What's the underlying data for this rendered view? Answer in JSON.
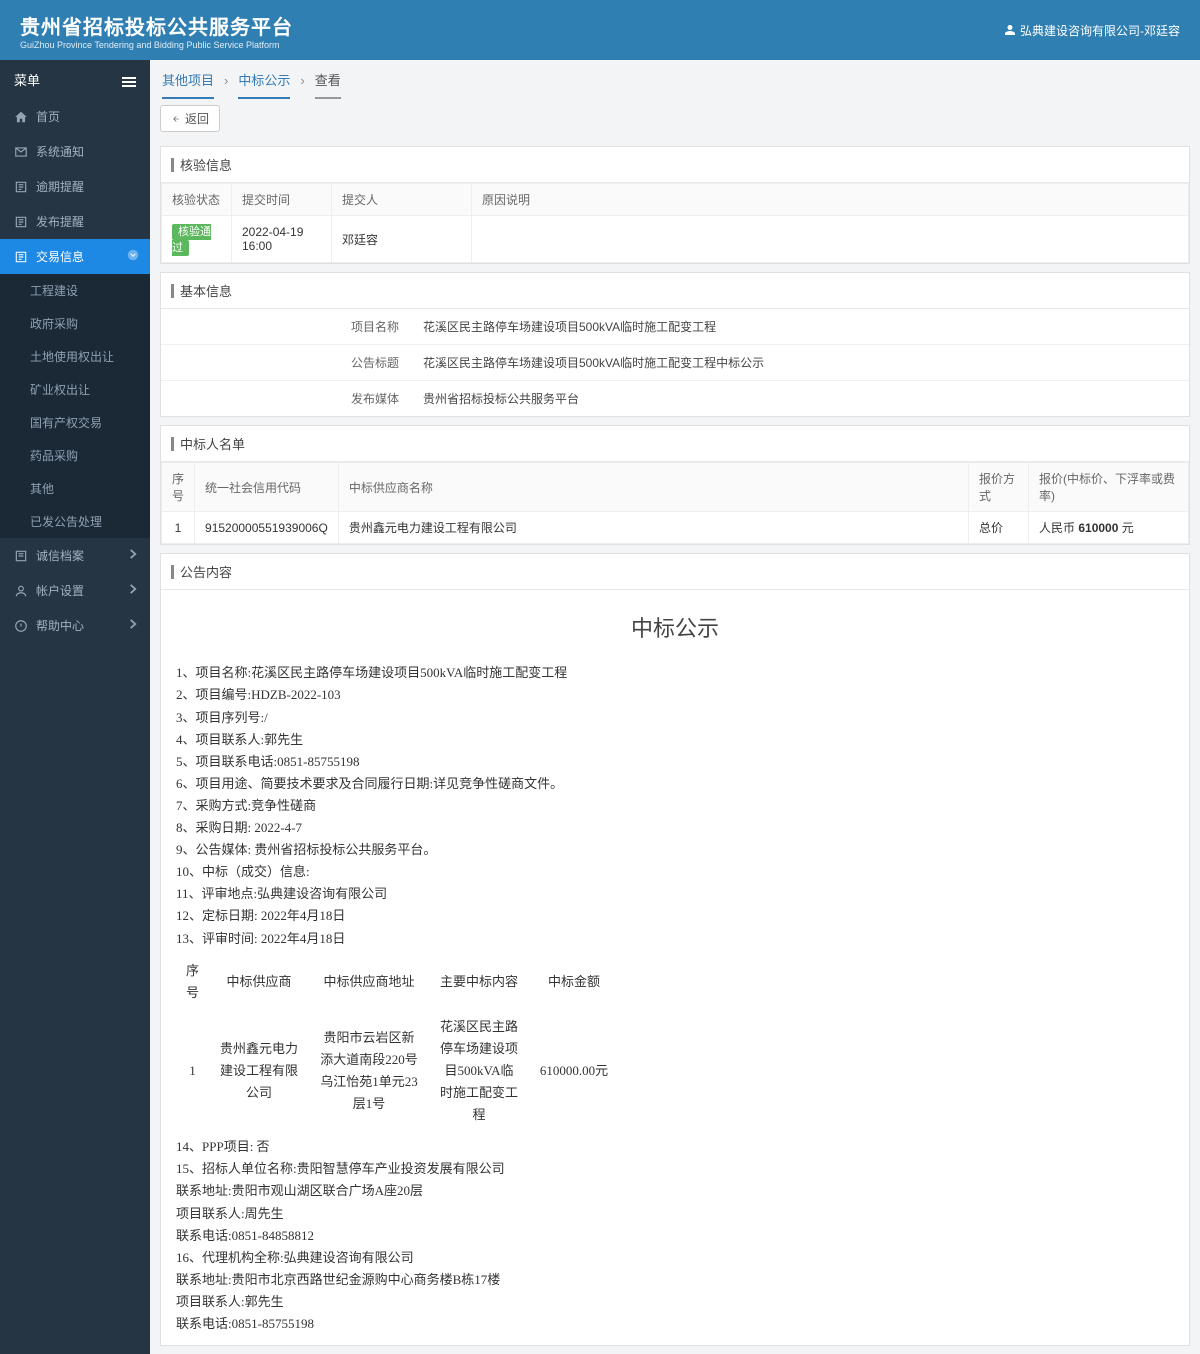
{
  "header": {
    "title": "贵州省招标投标公共服务平台",
    "subtitle": "GuiZhou Province Tendering and Bidding Public Service Platform",
    "user": "弘典建设咨询有限公司-邓廷容"
  },
  "sidebar": {
    "title": "菜单",
    "items": [
      {
        "label": "首页"
      },
      {
        "label": "系统通知"
      },
      {
        "label": "逾期提醒"
      },
      {
        "label": "发布提醒"
      },
      {
        "label": "交易信息",
        "active": true,
        "sub": [
          {
            "label": "工程建设"
          },
          {
            "label": "政府采购"
          },
          {
            "label": "土地使用权出让"
          },
          {
            "label": "矿业权出让"
          },
          {
            "label": "国有产权交易"
          },
          {
            "label": "药品采购"
          },
          {
            "label": "其他"
          },
          {
            "label": "已发公告处理"
          }
        ]
      },
      {
        "label": "诚信档案"
      },
      {
        "label": "帐户设置"
      },
      {
        "label": "帮助中心"
      }
    ]
  },
  "breadcrumb": {
    "a": "其他项目",
    "b": "中标公示",
    "c": "查看"
  },
  "back_label": "返回",
  "panel_verify": {
    "title": "核验信息",
    "cols": [
      "核验状态",
      "提交时间",
      "提交人",
      "原因说明"
    ],
    "row": {
      "status": "核验通过",
      "time": "2022-04-19 16:00",
      "person": "邓廷容",
      "reason": ""
    }
  },
  "panel_basic": {
    "title": "基本信息",
    "rows": [
      {
        "label": "项目名称",
        "value": "花溪区民主路停车场建设项目500kVA临时施工配变工程"
      },
      {
        "label": "公告标题",
        "value": "花溪区民主路停车场建设项目500kVA临时施工配变工程中标公示"
      },
      {
        "label": "发布媒体",
        "value": "贵州省招标投标公共服务平台"
      }
    ]
  },
  "panel_winners": {
    "title": "中标人名单",
    "cols": [
      "序号",
      "统一社会信用代码",
      "中标供应商名称",
      "报价方式",
      "报价(中标价、下浮率或费率)"
    ],
    "row": {
      "no": "1",
      "code": "91520000551939006Q",
      "name": "贵州鑫元电力建设工程有限公司",
      "method": "总价",
      "price_prefix": "人民币 ",
      "price": "610000",
      "price_suffix": " 元"
    }
  },
  "panel_content": {
    "title": "公告内容",
    "heading": "中标公示",
    "lines": [
      "1、项目名称:花溪区民主路停车场建设项目500kVA临时施工配变工程",
      "2、项目编号:HDZB-2022-103",
      "3、项目序列号:/",
      "4、项目联系人:郭先生",
      "5、项目联系电话:0851-85755198",
      "6、项目用途、简要技术要求及合同履行日期:详见竞争性磋商文件。",
      "7、采购方式:竞争性磋商",
      "8、采购日期: 2022-4-7",
      "9、公告媒体: 贵州省招标投标公共服务平台。",
      "10、中标（成交）信息:",
      "11、评审地点:弘典建设咨询有限公司",
      "12、定标日期:  2022年4月18日",
      "13、评审时间: 2022年4月18日"
    ],
    "inner_table": {
      "headers": [
        "序号",
        "中标供应商",
        "中标供应商地址",
        "主要中标内容",
        "中标金额"
      ],
      "row": [
        "1",
        "贵州鑫元电力建设工程有限公司",
        "贵阳市云岩区新添大道南段220号乌江怡苑1单元23层1号",
        "花溪区民主路停车场建设项目500kVA临时施工配变工程",
        "610000.00元"
      ]
    },
    "tail": [
      "14、PPP项目: 否",
      "15、招标人单位名称:贵阳智慧停车产业投资发展有限公司",
      "联系地址:贵阳市观山湖区联合广场A座20层",
      "项目联系人:周先生",
      "联系电话:0851-84858812",
      "16、代理机构全称:弘典建设咨询有限公司",
      "联系地址:贵阳市北京西路世纪金源购中心商务楼B栋17楼",
      "项目联系人:郭先生",
      "联系电话:0851-85755198"
    ]
  }
}
